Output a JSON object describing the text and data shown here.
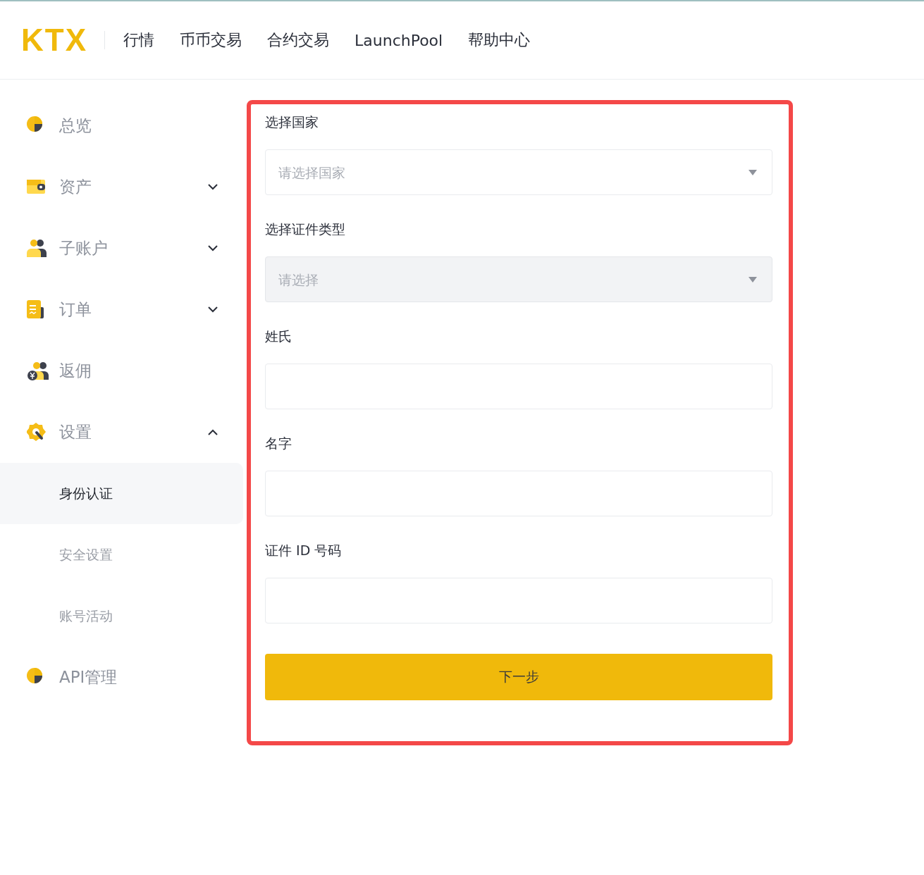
{
  "header": {
    "logo": "KTX",
    "nav": [
      "行情",
      "币币交易",
      "合约交易",
      "LaunchPool",
      "帮助中心"
    ]
  },
  "sidebar": {
    "items": [
      {
        "label": "总览"
      },
      {
        "label": "资产",
        "expanded": false
      },
      {
        "label": "子账户",
        "expanded": false
      },
      {
        "label": "订单",
        "expanded": false
      },
      {
        "label": "返佣"
      },
      {
        "label": "设置",
        "expanded": true,
        "children": [
          {
            "label": "身份认证",
            "selected": true
          },
          {
            "label": "安全设置",
            "selected": false
          },
          {
            "label": "账号活动",
            "selected": false
          }
        ]
      },
      {
        "label": "API管理"
      }
    ]
  },
  "form": {
    "fields": [
      {
        "kind": "select",
        "label": "选择国家",
        "placeholder": "请选择国家",
        "disabled": false
      },
      {
        "kind": "select",
        "label": "选择证件类型",
        "placeholder": "请选择",
        "disabled": true
      },
      {
        "kind": "text",
        "label": "姓氏"
      },
      {
        "kind": "text",
        "label": "名字"
      },
      {
        "kind": "text",
        "label": "证件 ID 号码"
      }
    ],
    "submit": "下一步"
  }
}
